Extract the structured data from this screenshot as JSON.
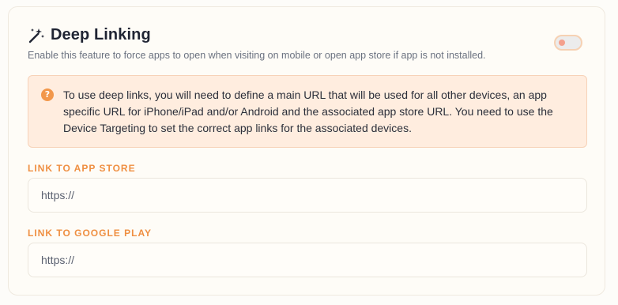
{
  "header": {
    "title": "Deep Linking",
    "icon": "magic-wand-icon",
    "subtitle": "Enable this feature to force apps to open when visiting on mobile or open app store if app is not installed."
  },
  "toggle": {
    "enabled": false
  },
  "notice": {
    "icon": "question-icon",
    "icon_glyph": "?",
    "text": "To use deep links, you will need to define a main URL that will be used for all other devices, an app specific URL for iPhone/iPad and/or Android and the associated app store URL. You need to use the Device Targeting to set the correct app links for the associated devices."
  },
  "fields": {
    "app_store": {
      "label": "LINK TO APP STORE",
      "placeholder": "https://",
      "value": ""
    },
    "google_play": {
      "label": "LINK TO GOOGLE PLAY",
      "placeholder": "https://",
      "value": ""
    }
  },
  "colors": {
    "accent": "#ef8f42",
    "notice_bg": "#ffeddf",
    "notice_border": "#f7d2b8",
    "title": "#1f2433"
  }
}
